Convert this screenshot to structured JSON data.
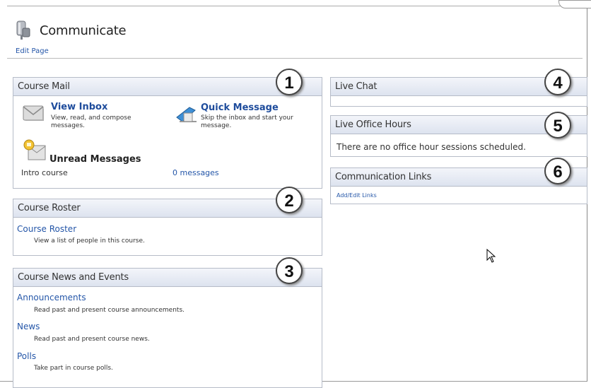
{
  "page": {
    "title": "Communicate",
    "edit_link": "Edit Page"
  },
  "course_mail": {
    "header": "Course Mail",
    "badge": "1",
    "view_inbox": {
      "title": "View Inbox",
      "desc": "View, read, and compose messages."
    },
    "quick_message": {
      "title": "Quick Message",
      "desc": "Skip the inbox and start your message."
    },
    "unread": {
      "title": "Unread Messages",
      "course": "Intro course",
      "count": "0 messages"
    }
  },
  "course_roster": {
    "header": "Course Roster",
    "badge": "2",
    "link": "Course Roster",
    "desc": "View a list of people in this course."
  },
  "course_news": {
    "header": "Course News and Events",
    "badge": "3",
    "items": [
      {
        "label": "Announcements",
        "desc": "Read past and present course announcements."
      },
      {
        "label": "News",
        "desc": "Read past and present course news."
      },
      {
        "label": "Polls",
        "desc": "Take part in course polls."
      }
    ]
  },
  "live_chat": {
    "header": "Live Chat",
    "badge": "4"
  },
  "live_office_hours": {
    "header": "Live Office Hours",
    "badge": "5",
    "text": "There are no office hour sessions scheduled."
  },
  "communication_links": {
    "header": "Communication Links",
    "badge": "6",
    "link": "Add/Edit Links"
  },
  "colors": {
    "link": "#2456a8",
    "header_bg": "#dde3ef",
    "border": "#b6bcc8"
  },
  "icons": [
    "communicate-icon",
    "envelope-icon",
    "quick-message-icon",
    "unread-mail-icon",
    "mouse-cursor-icon"
  ]
}
